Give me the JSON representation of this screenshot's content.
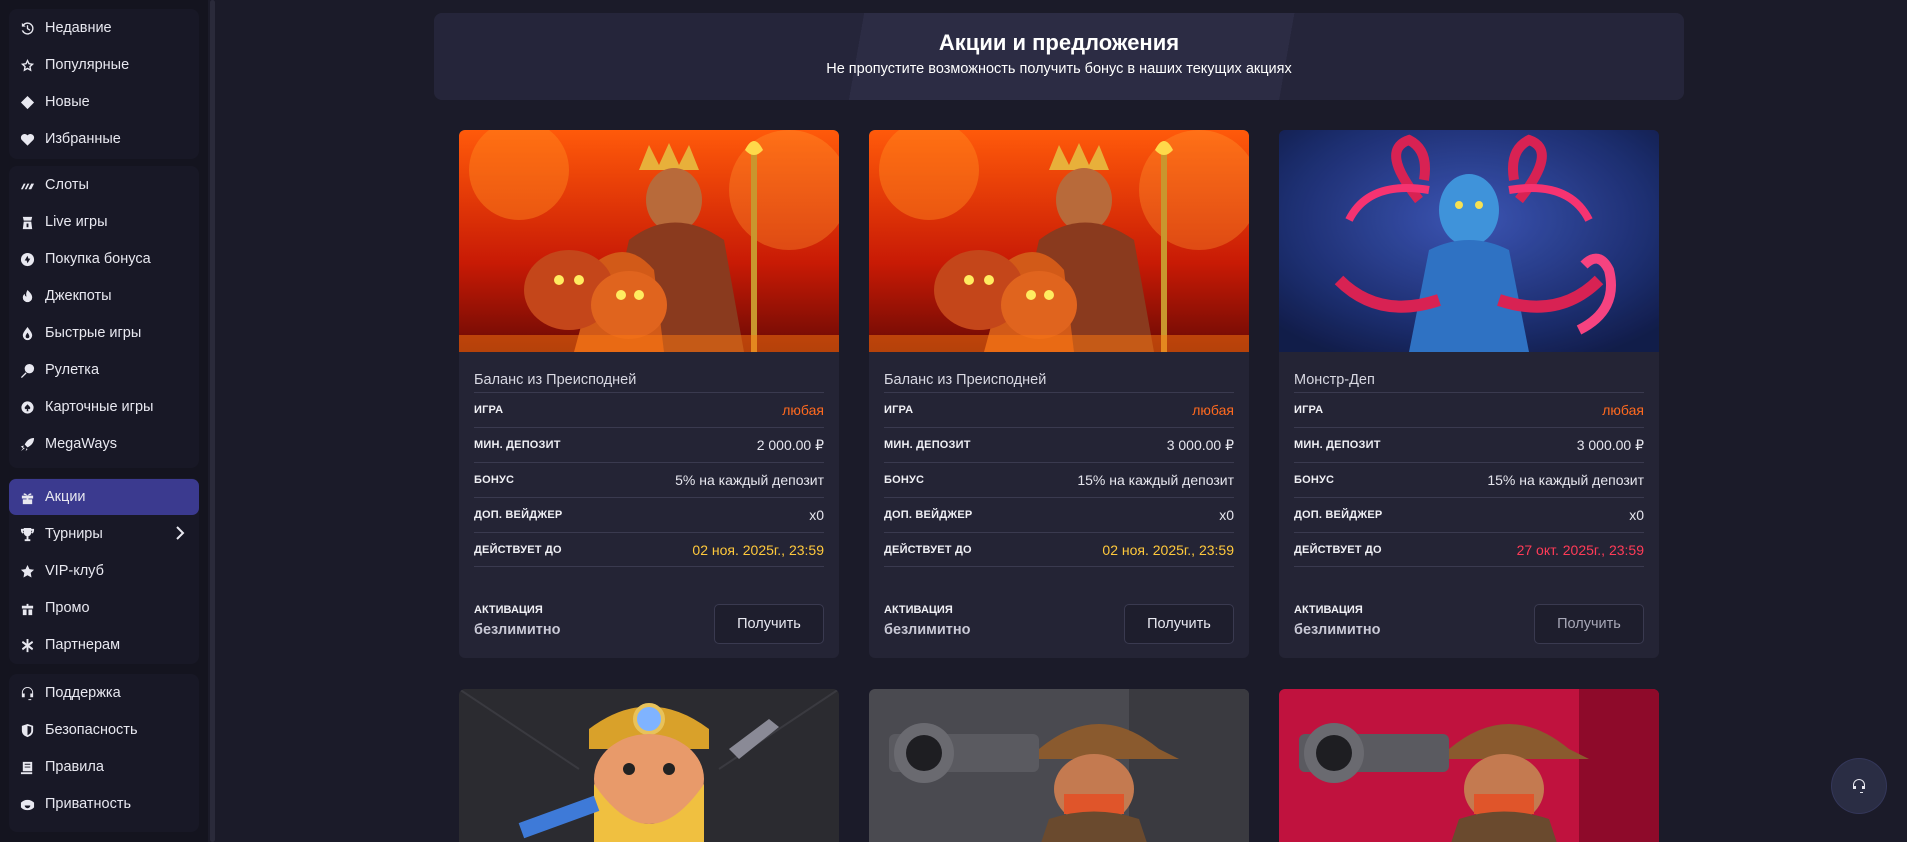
{
  "sidebar": {
    "groups": [
      {
        "items": [
          {
            "label": "Недавние",
            "icon": "history-icon"
          },
          {
            "label": "Популярные",
            "icon": "star-outline-icon"
          },
          {
            "label": "Новые",
            "icon": "diamond-icon"
          },
          {
            "label": "Избранные",
            "icon": "heart-icon"
          }
        ]
      },
      {
        "items": [
          {
            "label": "Слоты",
            "icon": "slots-icon"
          },
          {
            "label": "Live игры",
            "icon": "live-dealer-icon"
          },
          {
            "label": "Покупка бонуса",
            "icon": "bonus-buy-icon"
          },
          {
            "label": "Джекпоты",
            "icon": "flame-icon"
          },
          {
            "label": "Быстрые игры",
            "icon": "fire-drop-icon"
          },
          {
            "label": "Рулетка",
            "icon": "roulette-icon"
          },
          {
            "label": "Карточные игры",
            "icon": "cards-icon"
          },
          {
            "label": "MegaWays",
            "icon": "rocket-icon"
          }
        ]
      },
      {
        "items": [
          {
            "label": "Акции",
            "icon": "gift-icon",
            "active": true
          },
          {
            "label": "Турниры",
            "icon": "trophy-icon",
            "has_arrow": true
          },
          {
            "label": "VIP-клуб",
            "icon": "star-icon"
          },
          {
            "label": "Промо",
            "icon": "gift-box-icon"
          },
          {
            "label": "Партнерам",
            "icon": "partners-icon"
          }
        ]
      },
      {
        "items": [
          {
            "label": "Поддержка",
            "icon": "headset-icon"
          },
          {
            "label": "Безопасность",
            "icon": "shield-icon"
          },
          {
            "label": "Правила",
            "icon": "rules-icon"
          },
          {
            "label": "Приватность",
            "icon": "privacy-icon"
          }
        ]
      }
    ]
  },
  "banner": {
    "title": "Акции и предложения",
    "subtitle": "Не пропустите возможность получить бонус в наших текущих акциях"
  },
  "labels": {
    "game": "ИГРА",
    "min_deposit": "МИН. ДЕПОЗИТ",
    "bonus": "БОНУС",
    "extra_wager": "ДОП. ВЕЙДЖЕР",
    "valid_until": "ДЕЙСТВУЕТ ДО",
    "activation": "АКТИВАЦИЯ",
    "get_button": "Получить"
  },
  "promos": [
    {
      "title": "Баланс из Преисподней",
      "game": "любая",
      "min_deposit": "2 000.00 ₽",
      "bonus": "5% на каждый депозит",
      "extra_wager": "x0",
      "valid_until": "02 ноя. 2025г., 23:59",
      "valid_until_color": "yellow",
      "activation": "безлимитно",
      "image_icon": "hades-king-art"
    },
    {
      "title": "Баланс из Преисподней",
      "game": "любая",
      "min_deposit": "3 000.00 ₽",
      "bonus": "15% на каждый депозит",
      "extra_wager": "x0",
      "valid_until": "02 ноя. 2025г., 23:59",
      "valid_until_color": "yellow",
      "activation": "безлимитно",
      "image_icon": "hades-king-art"
    },
    {
      "title": "Монстр-Деп",
      "game": "любая",
      "min_deposit": "3 000.00 ₽",
      "bonus": "15% на каждый депозит",
      "extra_wager": "x0",
      "valid_until": "27 окт. 2025г., 23:59",
      "valid_until_color": "red",
      "activation": "безлимитно",
      "image_icon": "medusa-art"
    }
  ],
  "colors": {
    "accent_active": "#3b3a8f",
    "value_orange": "#ff6a1f",
    "date_yellow": "#ffc93c",
    "date_red": "#ff3b57"
  }
}
